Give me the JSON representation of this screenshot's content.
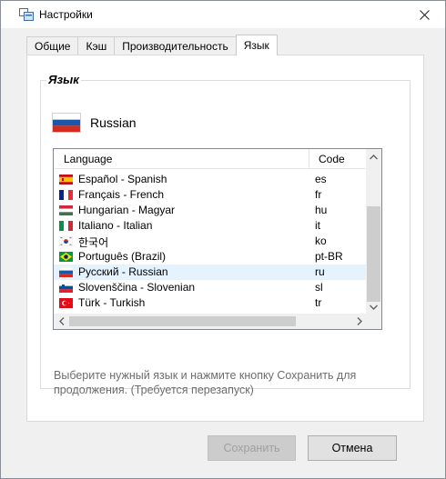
{
  "window": {
    "title": "Настройки",
    "close_icon": "close-icon"
  },
  "tabs": [
    {
      "label": "Общие",
      "active": false
    },
    {
      "label": "Кэш",
      "active": false
    },
    {
      "label": "Производительность",
      "active": false
    },
    {
      "label": "Язык",
      "active": true
    }
  ],
  "language_group": {
    "legend": "Язык",
    "current_language": "Russian",
    "current_flag": "ru"
  },
  "language_list": {
    "columns": [
      "Language",
      "Code"
    ],
    "rows": [
      {
        "name": "Español - Spanish",
        "code": "es",
        "flag": "es"
      },
      {
        "name": "Français - French",
        "code": "fr",
        "flag": "fr"
      },
      {
        "name": "Hungarian - Magyar",
        "code": "hu",
        "flag": "hu"
      },
      {
        "name": "Italiano - Italian",
        "code": "it",
        "flag": "it"
      },
      {
        "name": "한국어",
        "code": "ko",
        "flag": "ko"
      },
      {
        "name": "Português (Brazil)",
        "code": "pt-BR",
        "flag": "br"
      },
      {
        "name": "Русский - Russian",
        "code": "ru",
        "flag": "ru",
        "selected": true
      },
      {
        "name": "Slovenščina - Slovenian",
        "code": "sl",
        "flag": "sl"
      },
      {
        "name": "Türk - Turkish",
        "code": "tr",
        "flag": "tr"
      }
    ]
  },
  "hint_text": "Выберите нужный язык и нажмите кнопку Сохранить для продолжения. (Требуется перезапуск)",
  "buttons": {
    "save": "Сохранить",
    "cancel": "Отмена"
  },
  "colors": {
    "selection": "#e5f3ff",
    "dialog_bg": "#f0f0f0",
    "hint_text": "#6d6d6d"
  }
}
